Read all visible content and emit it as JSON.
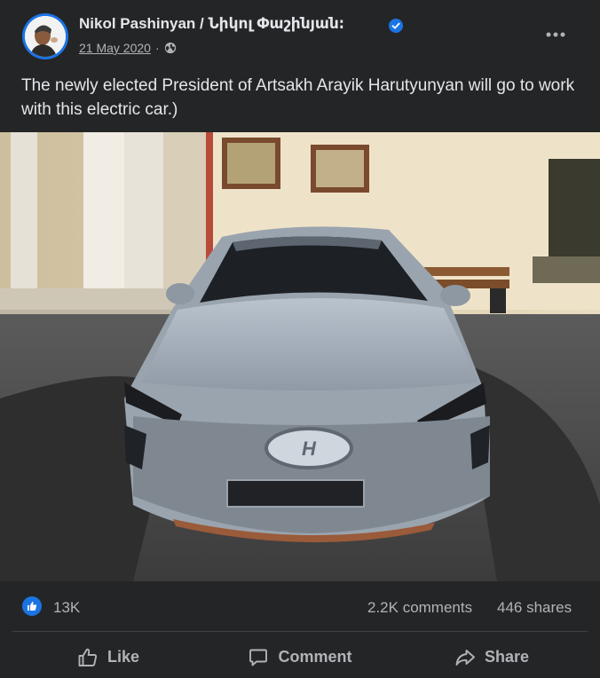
{
  "post": {
    "author": "Nikol Pashinyan / Նիկոլ Փաշինյան։",
    "date": "21 May 2020",
    "separator": "·",
    "privacy_icon": "globe-icon",
    "verified_icon": "verified-badge-icon",
    "more_icon": "more-horizontal-icon",
    "text": "The newly elected President of Artsakh Arayik Harutyunyan will go to work with this electric car.)"
  },
  "stats": {
    "reaction_icon": "like-reaction-icon",
    "likes": "13K",
    "comments": "2.2K comments",
    "shares": "446 shares"
  },
  "actions": {
    "like": "Like",
    "comment": "Comment",
    "share": "Share"
  },
  "colors": {
    "card_bg": "#242526",
    "text_primary": "#e4e6eb",
    "text_secondary": "#b0b3b8",
    "accent": "#1b74e4"
  }
}
